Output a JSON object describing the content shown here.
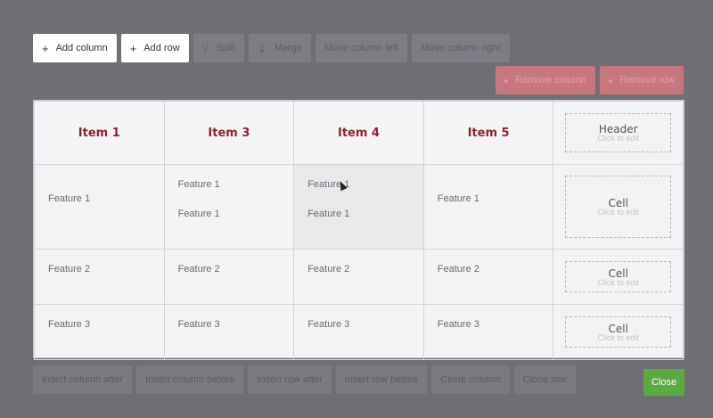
{
  "toolbar_top": {
    "add_column": "Add column",
    "add_row": "Add row",
    "split": "Split",
    "merge": "Merge",
    "move_column_left": "Move column left",
    "move_column_right": "Move column right"
  },
  "toolbar_right": {
    "remove_column": "Remove column",
    "remove_row": "Remove row"
  },
  "table": {
    "headers": [
      "Item 1",
      "Item 3",
      "Item 4",
      "Item 5"
    ],
    "header_editor": {
      "title": "Header",
      "hint": "Click to edit"
    },
    "rows": [
      {
        "cells": [
          [
            "Feature 1"
          ],
          [
            "Feature 1",
            "Feature 1"
          ],
          [
            "Feature 1",
            "Feature 1"
          ],
          [
            "Feature 1"
          ]
        ]
      },
      {
        "cells": [
          [
            "Feature 2"
          ],
          [
            "Feature 2"
          ],
          [
            "Feature 2"
          ],
          [
            "Feature 2"
          ]
        ]
      },
      {
        "cells": [
          [
            "Feature 3"
          ],
          [
            "Feature 3"
          ],
          [
            "Feature 3"
          ],
          [
            "Feature 3"
          ]
        ]
      }
    ],
    "cell_editor": {
      "title": "Cell",
      "hint": "Click to edit"
    }
  },
  "toolbar_bottom": {
    "insert_column_after": "Insert column after",
    "insert_column_before": "Insert column before",
    "insert_row_after": "Insert row after",
    "insert_row_before": "Insert row before",
    "clone_column": "Clone column",
    "clone_row": "Clone row"
  },
  "close_label": "Close",
  "colors": {
    "overlay": "#6f7076",
    "header_text": "#8c2431",
    "close_button": "#5aaa3f",
    "danger_button": "#c8767e"
  },
  "icons": {
    "add": "plus-icon",
    "split": "split-icon",
    "merge": "merge-icon",
    "remove": "trash-icon"
  }
}
